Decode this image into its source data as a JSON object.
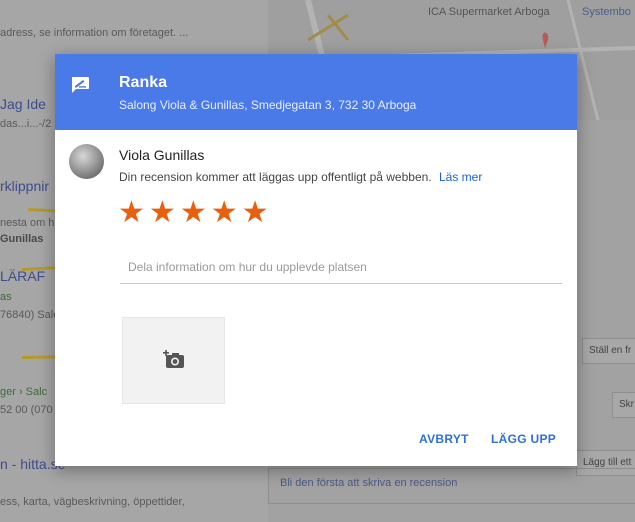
{
  "background": {
    "results": [
      {
        "snippet": "adress, se information om företaget. ..."
      },
      {
        "title": "Jag Ide",
        "snippet": "das...i...-/2"
      },
      {
        "title": "rklippnir",
        "snippet": "nesta om h",
        "bold": "Gunillas"
      },
      {
        "title": "LÄRAF",
        "breadcrumb": "as",
        "snippet": "76840) Salo"
      },
      {
        "breadcrumb": "ger › Salc",
        "snippet": "52 00 (070"
      },
      {
        "title": "n - hitta.se",
        "snippet": "ess, karta, vägbeskrivning, öppettider,"
      }
    ],
    "map": {
      "place_label": "ICA Supermarket Arboga",
      "place_label2": "Systembo"
    },
    "side_buttons": [
      "Ställ en fr",
      "Skr",
      "Lägg till ett"
    ],
    "review_prompt": "Bli den första att skriva en recension"
  },
  "dialog": {
    "title": "Ranka",
    "subtitle": "Salong Viola & Gunillas, Smedjegatan 3, 732 30 Arboga",
    "user_name": "Viola Gunillas",
    "notice": "Din recension kommer att läggas upp offentligt på webben.",
    "learn_more": "Läs mer",
    "rating": {
      "value": 5,
      "max": 5,
      "stars": [
        "★",
        "★",
        "★",
        "★",
        "★"
      ],
      "color": "#e8600e"
    },
    "review_placeholder": "Dela information om hur du upplevde platsen",
    "review_value": "",
    "buttons": {
      "cancel": "AVBRYT",
      "submit": "LÄGG UPP"
    },
    "header_color": "#4a79e8",
    "icons": {
      "header": "review-edit-icon",
      "photo": "add-photo-icon"
    }
  }
}
